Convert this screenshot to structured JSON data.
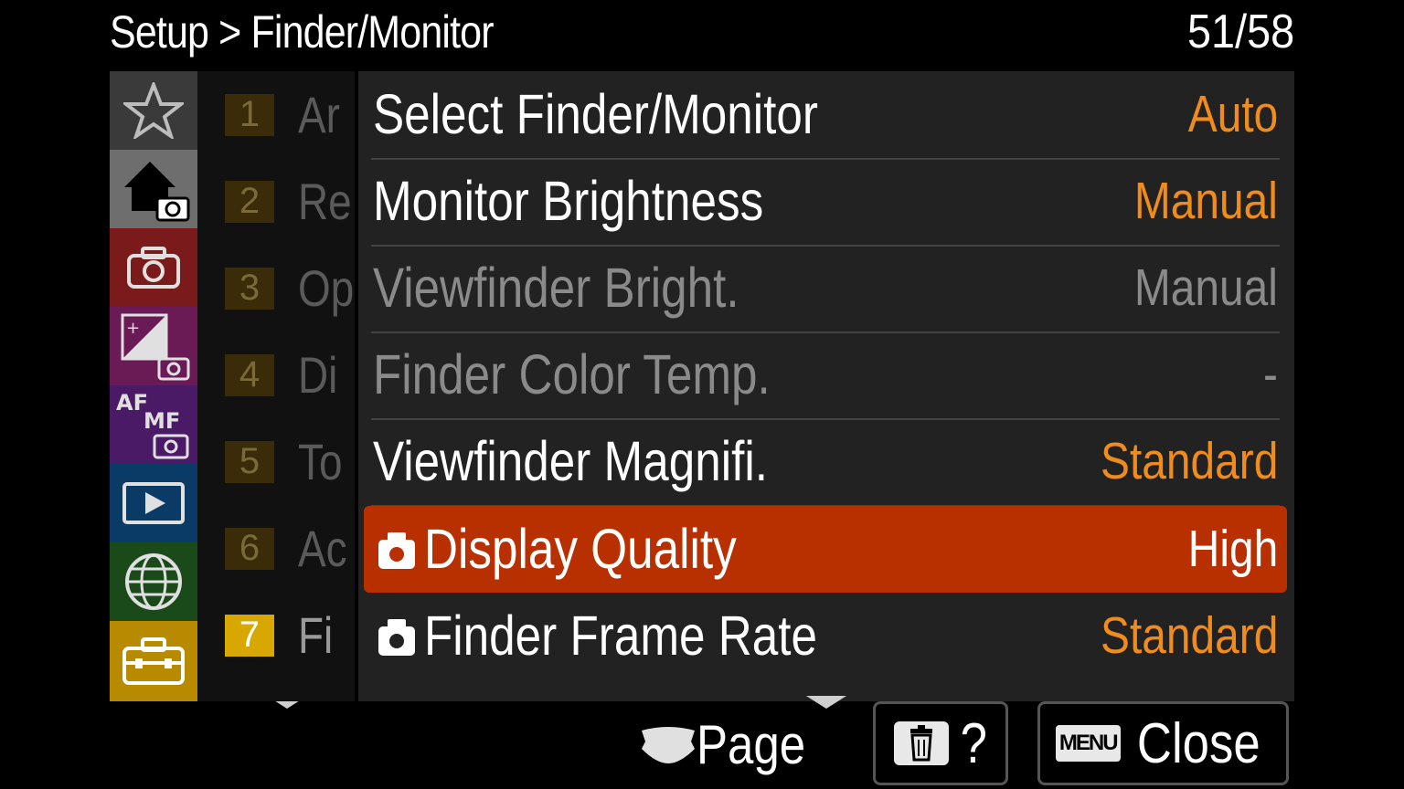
{
  "header": {
    "breadcrumb": "Setup > Finder/Monitor",
    "page_counter": "51/58"
  },
  "sidebar": {
    "categories": [
      {
        "name": "favorites",
        "icon": "star-icon",
        "color": "#3a3a3a",
        "active": false
      },
      {
        "name": "main",
        "icon": "home-camera-icon",
        "color": "#6e6e6e",
        "active": true
      },
      {
        "name": "shooting",
        "icon": "camera-icon",
        "color": "#7a1a1a",
        "active": false
      },
      {
        "name": "exposure",
        "icon": "exposure-icon",
        "color": "#6a1a55",
        "active": false
      },
      {
        "name": "focus",
        "icon": "af-mf-icon",
        "color": "#4a1a66",
        "active": false
      },
      {
        "name": "playback",
        "icon": "playback-icon",
        "color": "#0a3a66",
        "active": false
      },
      {
        "name": "network",
        "icon": "globe-icon",
        "color": "#1a4a1a",
        "active": false
      },
      {
        "name": "setup",
        "icon": "toolbox-icon",
        "color": "#b88a00",
        "active": true
      }
    ]
  },
  "sub_tabs": [
    {
      "num": "1",
      "label": "Ar",
      "active": false
    },
    {
      "num": "2",
      "label": "Re",
      "active": false
    },
    {
      "num": "3",
      "label": "Op",
      "active": false
    },
    {
      "num": "4",
      "label": "Di",
      "active": false
    },
    {
      "num": "5",
      "label": "To",
      "active": false
    },
    {
      "num": "6",
      "label": "Ac",
      "active": false
    },
    {
      "num": "7",
      "label": "Fi",
      "active": true
    }
  ],
  "menu_items": [
    {
      "label": "Select Finder/Monitor",
      "value": "Auto",
      "enabled": true,
      "selected": false,
      "camera_icon": false
    },
    {
      "label": "Monitor Brightness",
      "value": "Manual",
      "enabled": true,
      "selected": false,
      "camera_icon": false
    },
    {
      "label": "Viewfinder Bright.",
      "value": "Manual",
      "enabled": false,
      "selected": false,
      "camera_icon": false
    },
    {
      "label": "Finder Color Temp.",
      "value": "-",
      "enabled": false,
      "selected": false,
      "camera_icon": false
    },
    {
      "label": "Viewfinder Magnifi.",
      "value": "Standard",
      "enabled": true,
      "selected": false,
      "camera_icon": false
    },
    {
      "label": "Display Quality",
      "value": "High",
      "enabled": true,
      "selected": true,
      "camera_icon": true
    },
    {
      "label": "Finder Frame Rate",
      "value": "Standard",
      "enabled": true,
      "selected": false,
      "camera_icon": true
    }
  ],
  "footer": {
    "page_label": "Page",
    "help_label": "?",
    "menu_badge": "MENU",
    "close_label": "Close"
  },
  "colors": {
    "value_orange": "#f08c1e",
    "selected_bg": "#b83000"
  }
}
